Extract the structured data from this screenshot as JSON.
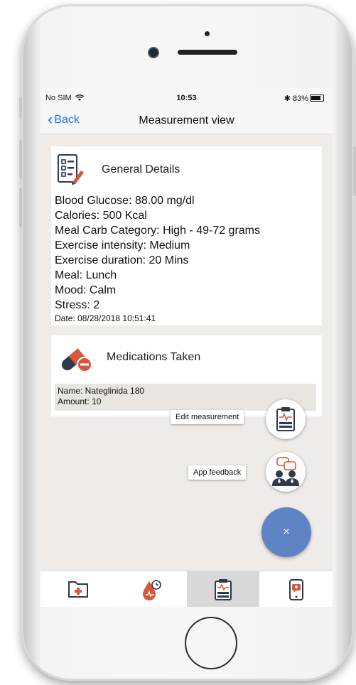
{
  "status_bar": {
    "carrier": "No SIM",
    "time": "10:53",
    "battery": "83%"
  },
  "nav": {
    "back_label": "Back",
    "title": "Measurement view"
  },
  "general_details": {
    "title": "General Details",
    "lines": [
      "Blood Glucose: 88.00 mg/dl",
      "Calories: 500 Kcal",
      "Meal Carb Category: High - 49-72 grams",
      "Exercise intensity: Medium",
      "Exercise duration: 20 Mins",
      "Meal: Lunch",
      "Mood: Calm",
      "Stress: 2"
    ],
    "date": "Date: 08/28/2018 10:51:41"
  },
  "medications": {
    "title": "Medications Taken",
    "name": "Name: Nateglinida 180",
    "amount": "Amount: 10"
  },
  "fab_menu": {
    "edit_label": "Edit measurement",
    "feedback_label": "App feedback",
    "close_symbol": "×"
  },
  "colors": {
    "accent_blue": "#1a73e8",
    "icon_red": "#d6573c",
    "fab_blue": "#5f84c6",
    "screen_bg": "#efebe8"
  },
  "tabs": [
    {
      "icon": "folder-medical-icon"
    },
    {
      "icon": "blood-drop-clock-icon"
    },
    {
      "icon": "clipboard-measurement-icon",
      "active": true
    },
    {
      "icon": "phone-message-icon"
    }
  ]
}
